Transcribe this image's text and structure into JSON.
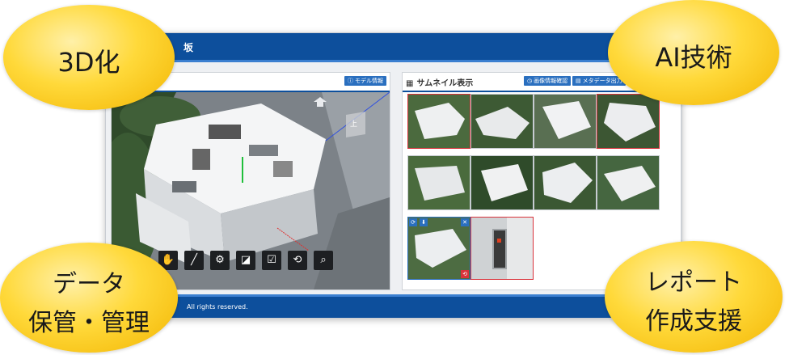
{
  "app": {
    "title": "坂",
    "left_panel": {
      "button_label": "モデル情報"
    },
    "right_panel": {
      "title": "サムネイル表示",
      "button1_label": "画像情報確認",
      "button2_label": "メタデータ出力"
    },
    "viewer": {
      "nav_label": "上"
    },
    "footer": {
      "copyright": "All rights reserved."
    },
    "thumbnails": [
      {
        "selected": true
      },
      {
        "selected": false
      },
      {
        "selected": false
      },
      {
        "selected": true
      },
      {
        "selected": false
      },
      {
        "selected": false
      },
      {
        "selected": false
      },
      {
        "selected": false
      },
      {
        "selected": false,
        "active": true
      },
      {
        "selected": true
      }
    ]
  },
  "bubbles": {
    "top_left": "3D化",
    "top_right": "AI技術",
    "bottom_left_line1": "データ",
    "bottom_left_line2": "保管・管理",
    "bottom_right_line1": "レポート",
    "bottom_right_line2": "作成支援"
  },
  "colors": {
    "primary": "#0d4f9c",
    "accent": "#2a6fbf",
    "selection": "#d9323a",
    "bubble": "#ffd93a"
  }
}
